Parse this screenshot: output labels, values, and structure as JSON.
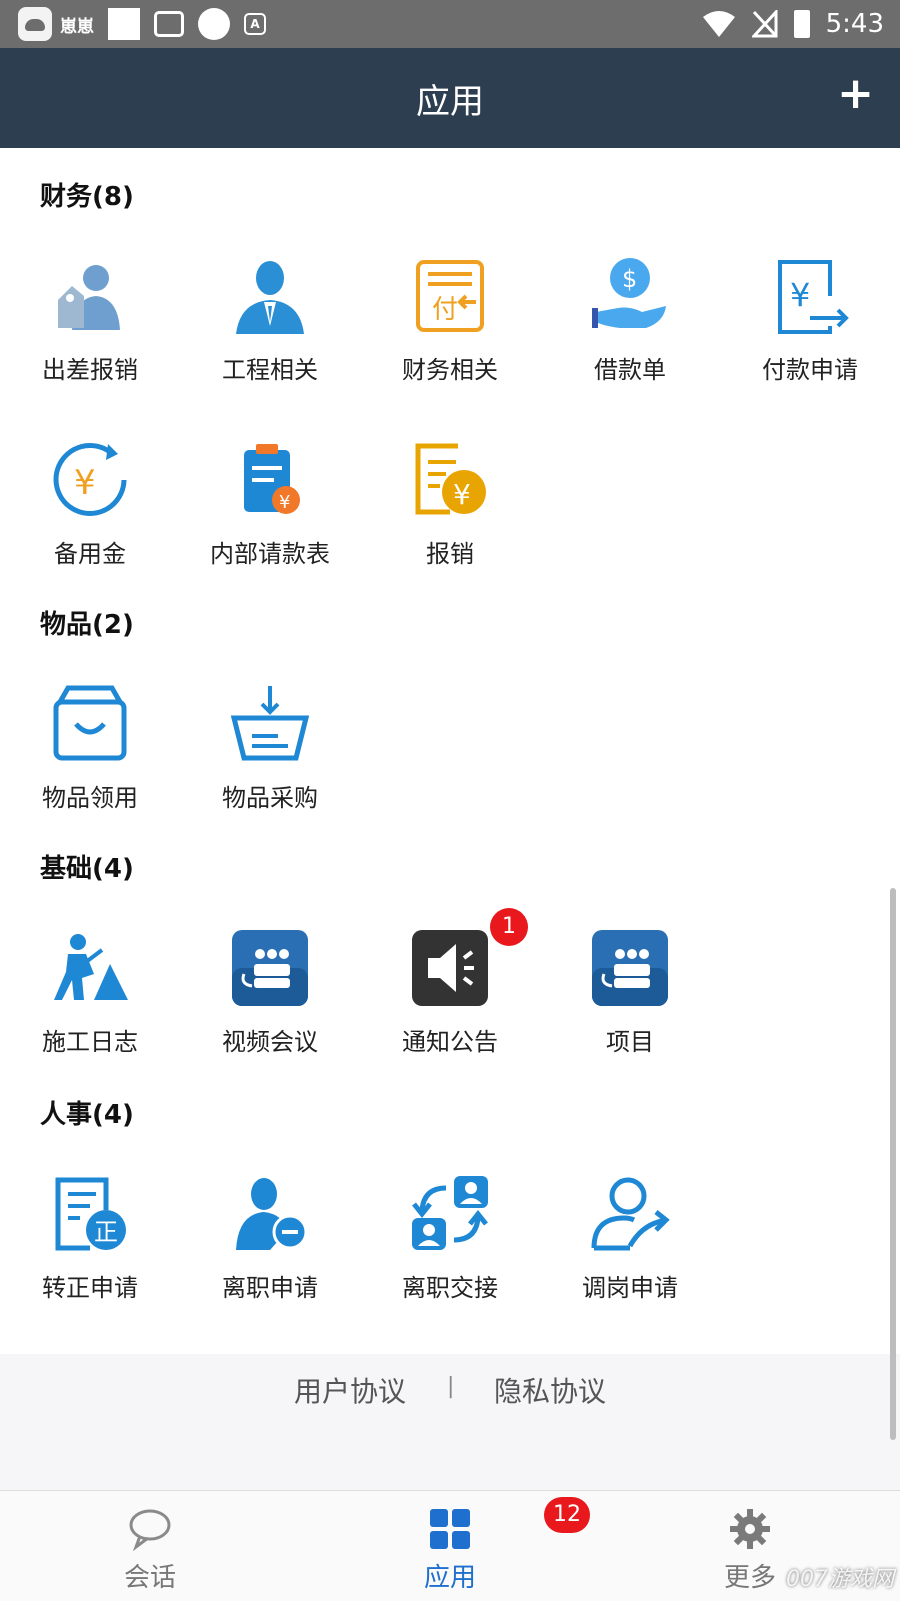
{
  "status_bar": {
    "app_name": "崽崽",
    "time": "5:43"
  },
  "header": {
    "title": "应用",
    "add_label": "+"
  },
  "sections": [
    {
      "title": "财务(8)",
      "items": [
        {
          "label": "出差报销",
          "icon": "business-trip-icon"
        },
        {
          "label": "工程相关",
          "icon": "engineer-icon"
        },
        {
          "label": "财务相关",
          "icon": "finance-doc-icon"
        },
        {
          "label": "借款单",
          "icon": "loan-icon"
        },
        {
          "label": "付款申请",
          "icon": "payment-request-icon"
        },
        {
          "label": "备用金",
          "icon": "petty-cash-icon"
        },
        {
          "label": "内部请款表",
          "icon": "internal-request-icon"
        },
        {
          "label": "报销",
          "icon": "reimbursement-icon"
        }
      ]
    },
    {
      "title": "物品(2)",
      "items": [
        {
          "label": "物品领用",
          "icon": "box-icon"
        },
        {
          "label": "物品采购",
          "icon": "basket-icon"
        }
      ]
    },
    {
      "title": "基础(4)",
      "items": [
        {
          "label": "施工日志",
          "icon": "construction-icon"
        },
        {
          "label": "视频会议",
          "icon": "meeting-icon"
        },
        {
          "label": "通知公告",
          "icon": "speaker-icon",
          "badge": "1"
        },
        {
          "label": "项目",
          "icon": "project-icon"
        }
      ]
    },
    {
      "title": "人事(4)",
      "items": [
        {
          "label": "转正申请",
          "icon": "regularization-icon"
        },
        {
          "label": "离职申请",
          "icon": "resignation-icon"
        },
        {
          "label": "离职交接",
          "icon": "handover-icon"
        },
        {
          "label": "调岗申请",
          "icon": "transfer-icon"
        }
      ]
    }
  ],
  "footer": {
    "user_agreement": "用户协议",
    "separator": "|",
    "privacy": "隐私协议"
  },
  "bottom_nav": [
    {
      "label": "会话",
      "icon": "chat-icon"
    },
    {
      "label": "应用",
      "icon": "apps-grid-icon",
      "badge": "12"
    },
    {
      "label": "更多",
      "icon": "gear-icon"
    }
  ],
  "watermark": "007游戏网",
  "colors": {
    "header": "#2d3e50",
    "accent": "#1f6fcf",
    "icon_blue": "#2b8fd6",
    "icon_orange": "#f0a020",
    "badge": "#e8181c"
  }
}
